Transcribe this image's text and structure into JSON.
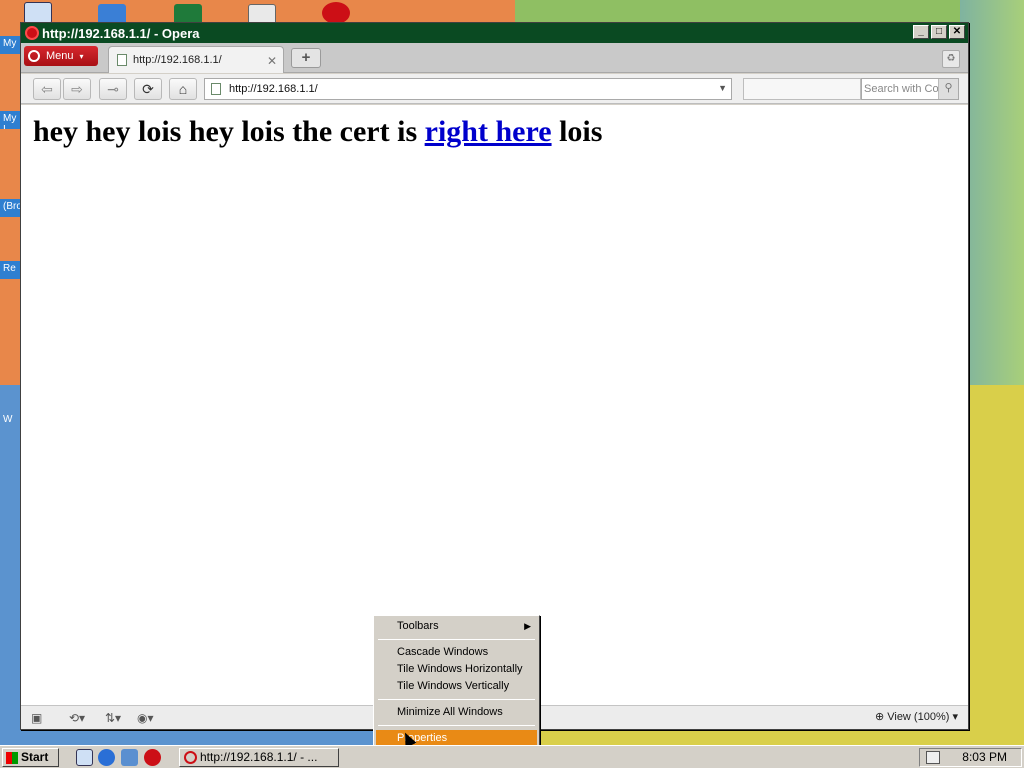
{
  "window": {
    "title": "http://192.168.1.1/ - Opera",
    "menu_label": "Menu"
  },
  "tab": {
    "label": "http://192.168.1.1/"
  },
  "navbar": {
    "address": "http://192.168.1.1/",
    "search_placeholder": "Search with Co"
  },
  "page": {
    "text_before": "hey hey lois hey lois the cert is ",
    "link_text": "right here",
    "text_after": " lois"
  },
  "statusbar": {
    "zoom_label": "View (100%)"
  },
  "context_menu": {
    "items": [
      {
        "label": "Toolbars"
      },
      {
        "label": "Cascade Windows"
      },
      {
        "label": "Tile Windows Horizontally"
      },
      {
        "label": "Tile Windows Vertically"
      },
      {
        "label": "Minimize All Windows"
      },
      {
        "label": "Properties"
      }
    ]
  },
  "desktop": {
    "side_labels": [
      "My",
      "My I",
      "(Bro",
      "Re",
      "W"
    ]
  },
  "taskbar": {
    "start_label": "Start",
    "task_label": "http://192.168.1.1/ - ...",
    "clock": "8:03 PM"
  },
  "colors": {
    "accent_menu": "#e98a15",
    "opera_red": "#cc0f16",
    "link": "#0000cc"
  }
}
